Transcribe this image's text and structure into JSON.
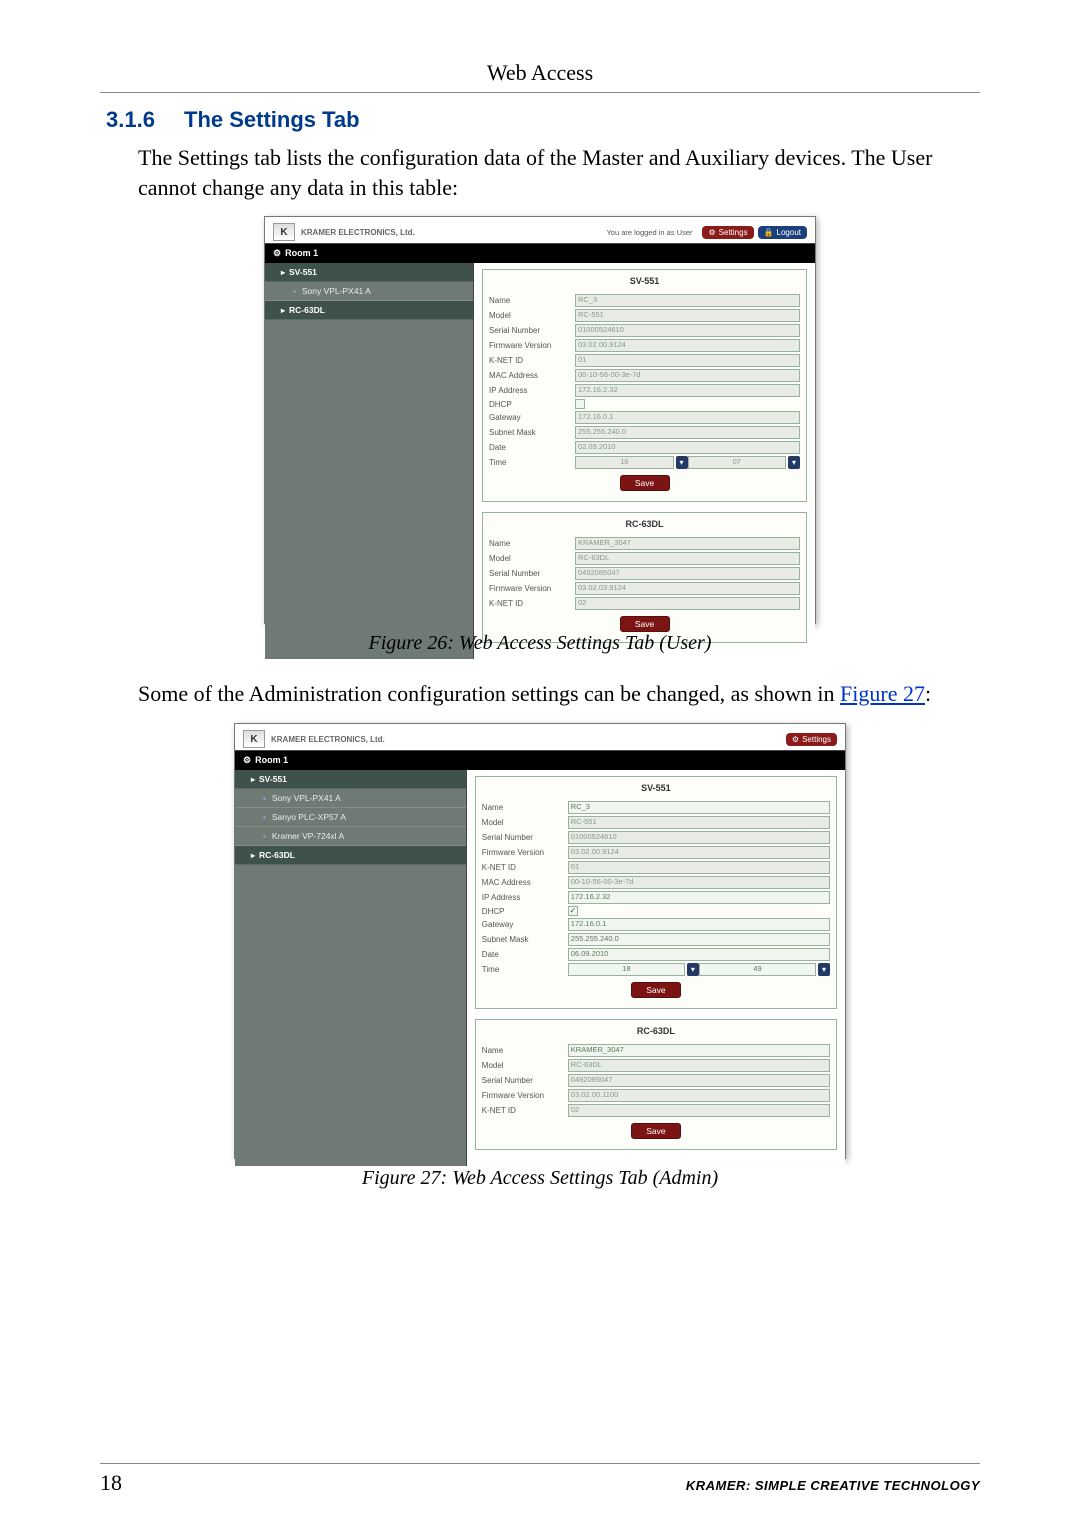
{
  "header": {
    "title": "Web Access"
  },
  "section": {
    "number": "3.1.6",
    "title": "The Settings Tab"
  },
  "para1": "The Settings tab lists the configuration data of the Master and Auxiliary devices. The User cannot change any data in this table:",
  "para2a": "Some of the Administration configuration settings can be changed, as shown in ",
  "para2_link": "Figure 27",
  "para2b": ":",
  "fig26_caption": "Figure 26: Web Access Settings Tab (User)",
  "fig27_caption": "Figure 27: Web Access Settings Tab (Admin)",
  "footer": {
    "page": "18",
    "brand": "KRAMER:  SIMPLE CREATIVE TECHNOLOGY"
  },
  "shotA": {
    "brand": "KRAMER ELECTRONICS, Ltd.",
    "login_note": "You are logged in as User",
    "btn_settings": "Settings",
    "btn_logout": "Logout",
    "room": "Room 1",
    "sidebar": [
      "SV-551",
      "Sony VPL-PX41 A",
      "RC-63DL"
    ],
    "panel1": {
      "title": "SV-551",
      "rows": {
        "name_l": "Name",
        "name_v": "RC_3",
        "model_l": "Model",
        "model_v": "RC-551",
        "sn_l": "Serial Number",
        "sn_v": "01000524610",
        "fw_l": "Firmware Version",
        "fw_v": "03.02.00.9124",
        "knet_l": "K-NET ID",
        "knet_v": "01",
        "mac_l": "MAC Address",
        "mac_v": "00-10-56-00-3e-7d",
        "ip_l": "IP Address",
        "ip_v": "172.16.2.32",
        "dhcp_l": "DHCP",
        "gw_l": "Gateway",
        "gw_v": "172.16.0.1",
        "mask_l": "Subnet Mask",
        "mask_v": "255.255.240.0",
        "date_l": "Date",
        "date_v": "02.09.2010",
        "time_l": "Time",
        "time_h": "16",
        "time_m": "07"
      },
      "save": "Save"
    },
    "panel2": {
      "title": "RC-63DL",
      "rows": {
        "name_l": "Name",
        "name_v": "KRAMER_3047",
        "model_l": "Model",
        "model_v": "RC-63DL",
        "sn_l": "Serial Number",
        "sn_v": "0492085047",
        "fw_l": "Firmware Version",
        "fw_v": "03.02.03.9124",
        "knet_l": "K-NET ID",
        "knet_v": "02"
      },
      "save": "Save"
    }
  },
  "shotB": {
    "brand": "KRAMER ELECTRONICS, Ltd.",
    "btn_settings": "Settings",
    "room": "Room 1",
    "sidebar": [
      "SV-551",
      "Sony VPL-PX41 A",
      "Sanyo PLC-XP57 A",
      "Kramer VP-724xl A",
      "RC-63DL"
    ],
    "panel1": {
      "title": "SV-551",
      "rows": {
        "name_l": "Name",
        "name_v": "RC_3",
        "model_l": "Model",
        "model_v": "RC-551",
        "sn_l": "Serial Number",
        "sn_v": "01000524610",
        "fw_l": "Firmware Version",
        "fw_v": "03.02.00.9124",
        "knet_l": "K-NET ID",
        "knet_v": "01",
        "mac_l": "MAC Address",
        "mac_v": "00-10-56-00-3e-7d",
        "ip_l": "IP Address",
        "ip_v": "172.16.2.32",
        "dhcp_l": "DHCP",
        "gw_l": "Gateway",
        "gw_v": "172.16.0.1",
        "mask_l": "Subnet Mask",
        "mask_v": "255.255.240.0",
        "date_l": "Date",
        "date_v": "06.09.2010",
        "time_l": "Time",
        "time_h": "18",
        "time_m": "49"
      },
      "save": "Save"
    },
    "panel2": {
      "title": "RC-63DL",
      "rows": {
        "name_l": "Name",
        "name_v": "KRAMER_3047",
        "model_l": "Model",
        "model_v": "RC-63DL",
        "sn_l": "Serial Number",
        "sn_v": "0492085047",
        "fw_l": "Firmware Version",
        "fw_v": "03.02.00.1100",
        "knet_l": "K-NET ID",
        "knet_v": "02"
      },
      "save": "Save"
    }
  }
}
